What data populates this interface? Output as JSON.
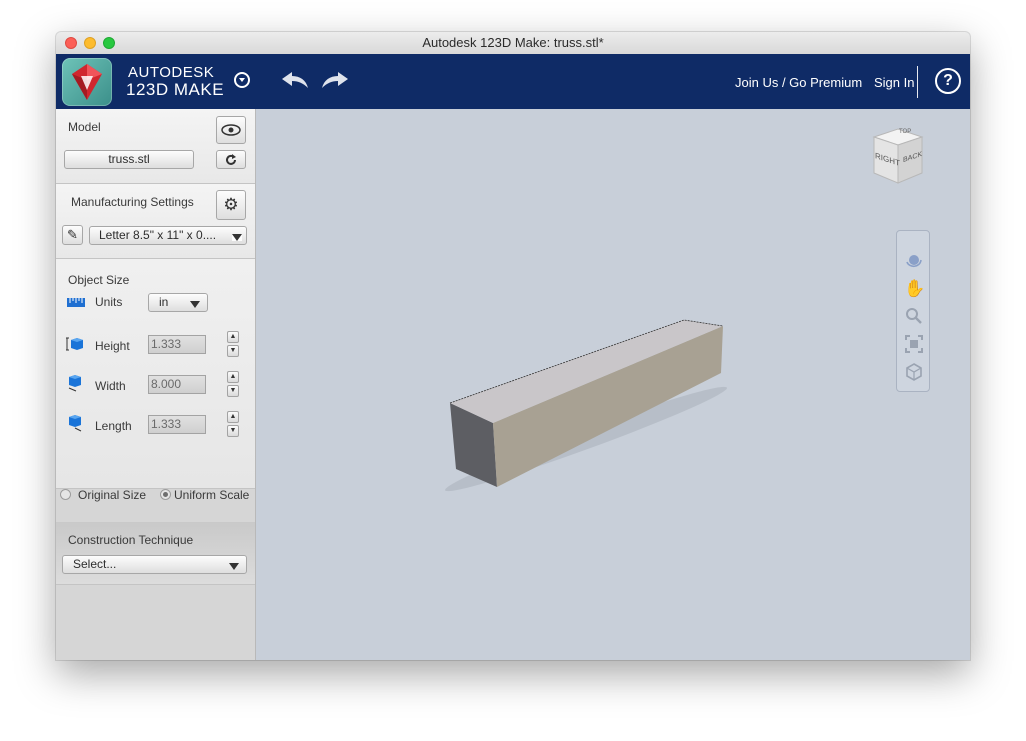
{
  "window": {
    "title": "Autodesk 123D Make: truss.stl*"
  },
  "brand": {
    "line1": "AUTODESK",
    "line2": "123D MAKE"
  },
  "header": {
    "join_label": "Join Us / Go Premium",
    "signin_label": "Sign In",
    "help_label": "?"
  },
  "model": {
    "section_label": "Model",
    "file_label": "truss.stl"
  },
  "manufacturing": {
    "section_label": "Manufacturing Settings",
    "sheet_value": "Letter 8.5\" x 11\" x 0...."
  },
  "object_size": {
    "section_label": "Object Size",
    "units_label": "Units",
    "units_value": "in",
    "height_label": "Height",
    "height_value": "1.333",
    "width_label": "Width",
    "width_value": "8.000",
    "length_label": "Length",
    "length_value": "1.333",
    "original_size_label": "Original Size",
    "uniform_scale_label": "Uniform Scale",
    "scale_mode": "Uniform Scale"
  },
  "construction": {
    "section_label": "Construction Technique",
    "select_value": "Select..."
  },
  "viewcube": {
    "face_right": "RIGHT",
    "face_back": "BACK",
    "face_top": "TOP"
  },
  "nav_tools": [
    "orbit-icon",
    "pan-icon",
    "zoom-icon",
    "fit-icon",
    "home-view-icon"
  ],
  "colors": {
    "app_header": "#0f2b66",
    "viewport_bg": "#c8cfd9",
    "box_top": "#c9c6c9",
    "box_front": "#a8a193",
    "box_end": "#5d5e63"
  }
}
